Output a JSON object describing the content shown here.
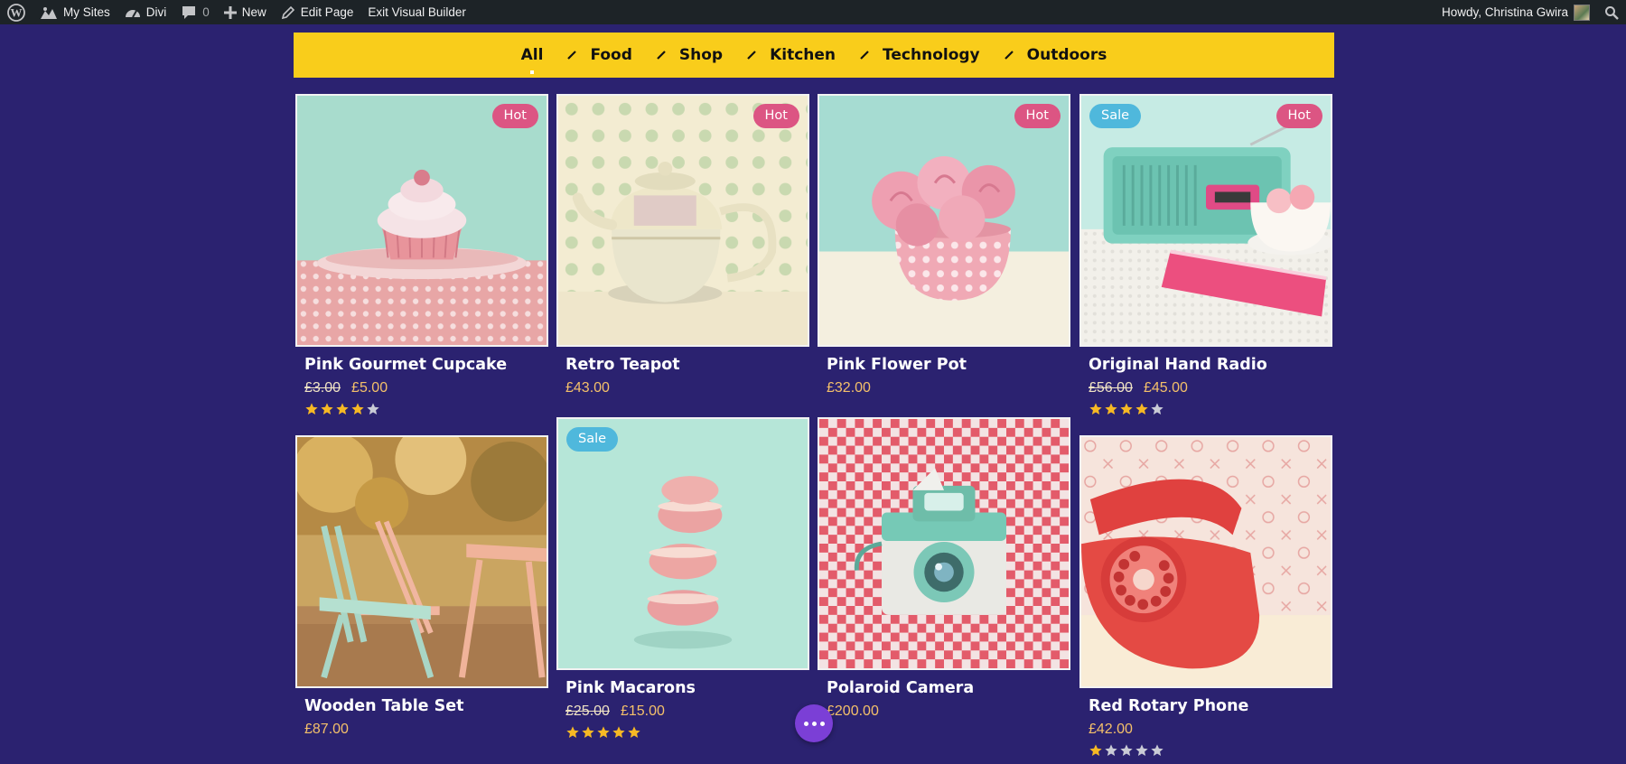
{
  "adminbar": {
    "my_sites": "My Sites",
    "divi": "Divi",
    "comments_count": "0",
    "new": "New",
    "edit_page": "Edit Page",
    "exit_builder": "Exit Visual Builder",
    "howdy": "Howdy, Christina Gwira"
  },
  "filters": {
    "items": [
      {
        "label": "All",
        "active": true
      },
      {
        "label": "Food",
        "active": false
      },
      {
        "label": "Shop",
        "active": false
      },
      {
        "label": "Kitchen",
        "active": false
      },
      {
        "label": "Technology",
        "active": false
      },
      {
        "label": "Outdoors",
        "active": false
      }
    ]
  },
  "products": [
    {
      "title": "Pink Gourmet Cupcake",
      "old_price": "£3.00",
      "price": "£5.00",
      "rating": 4,
      "badges": [
        "Hot"
      ],
      "image": "cupcake"
    },
    {
      "title": "Retro Teapot",
      "old_price": "",
      "price": "£43.00",
      "rating": 0,
      "badges": [
        "Hot"
      ],
      "image": "teapot"
    },
    {
      "title": "Pink Flower Pot",
      "old_price": "",
      "price": "£32.00",
      "rating": 0,
      "badges": [
        "Hot"
      ],
      "image": "flower-pot"
    },
    {
      "title": "Original Hand Radio",
      "old_price": "£56.00",
      "price": "£45.00",
      "rating": 4,
      "badges": [
        "Sale",
        "Hot"
      ],
      "image": "radio"
    },
    {
      "title": "Wooden Table Set",
      "old_price": "",
      "price": "£87.00",
      "rating": 0,
      "badges": [],
      "image": "table-set"
    },
    {
      "title": "Pink Macarons",
      "old_price": "£25.00",
      "price": "£15.00",
      "rating": 5,
      "badges": [
        "Sale"
      ],
      "image": "macarons"
    },
    {
      "title": "Polaroid Camera",
      "old_price": "",
      "price": "£200.00",
      "rating": 0,
      "badges": [],
      "image": "camera"
    },
    {
      "title": "Red Rotary Phone",
      "old_price": "",
      "price": "£42.00",
      "rating": 1,
      "badges": [],
      "image": "phone"
    }
  ],
  "colors": {
    "page_bg": "#2b2270",
    "filter_bg": "#f9cd1b",
    "hot_badge": "#dc5583",
    "sale_badge": "#4fb8dc",
    "price": "#f4c06a",
    "star_on": "#f7b924",
    "star_off": "#c9cbd6",
    "fab": "#7b3fd6"
  }
}
